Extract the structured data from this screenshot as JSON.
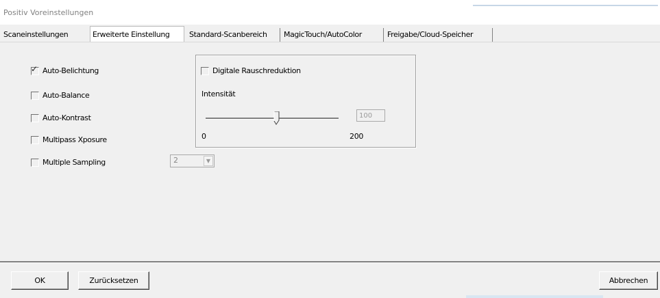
{
  "window": {
    "title": "Positiv Voreinstellungen"
  },
  "tabs": [
    {
      "label": "Scaneinstellungen",
      "active": false
    },
    {
      "label": "Erweiterte Einstellung",
      "active": true
    },
    {
      "label": "Standard-Scanbereich",
      "active": false
    },
    {
      "label": "MagicTouch/AutoColor",
      "active": false
    },
    {
      "label": "Freigabe/Cloud-Speicher",
      "active": false
    }
  ],
  "options": {
    "auto_belichtung": {
      "label": "Auto-Belichtung",
      "checked": true
    },
    "auto_balance": {
      "label": "Auto-Balance",
      "checked": false
    },
    "auto_kontrast": {
      "label": "Auto-Kontrast",
      "checked": false
    },
    "multipass": {
      "label": "Multipass Xposure",
      "checked": false
    },
    "multiple_sampling": {
      "label": "Multiple Sampling",
      "checked": false,
      "value": "2"
    }
  },
  "noise": {
    "label": "Digitale Rauschreduktion",
    "checked": false,
    "intensity_label": "Intensität",
    "value": "100",
    "min_label": "0",
    "max_label": "200",
    "slider_value": 100,
    "slider_min": 0,
    "slider_max": 200
  },
  "buttons": {
    "ok": "OK",
    "reset": "Zurücksetzen",
    "cancel": "Abbrechen"
  },
  "colors": {
    "background": "#f0f0f0",
    "disabled_text": "#999999",
    "title_text": "#808080"
  }
}
